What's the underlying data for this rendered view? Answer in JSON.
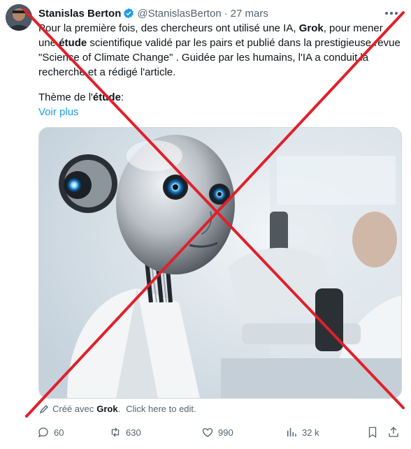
{
  "tweet": {
    "author_name": "Stanislas Berton",
    "handle": "@StanislasBerton",
    "separator": "·",
    "date": "27 mars",
    "text_segments": [
      "Pour la première fois, des chercheurs ont utilisé une IA, ",
      "Grok",
      ", pour mener une ",
      "étude",
      " scientifique validé par les pairs et publié dans la prestigieuse revue \"Science of Climate Change\" . Guidée par les humains, l'IA a conduit la recherche et a rédigé l'article."
    ],
    "theme_prefix": "Thème de l'",
    "theme_bold": "étude",
    "theme_suffix": ":",
    "see_more": "Voir plus",
    "created_prefix": "Créé avec",
    "created_brand": "Grok",
    "created_suffix": ".",
    "created_edit": "Click here to edit."
  },
  "actions": {
    "replies": "60",
    "reposts": "630",
    "likes": "990",
    "views": "32 k"
  },
  "icons": {
    "verified": "verified-badge-icon",
    "more": "more-horizontal-icon",
    "pen": "pen-icon",
    "reply": "reply-icon",
    "repost": "repost-icon",
    "like": "heart-icon",
    "views": "views-bar-chart-icon",
    "bookmark": "bookmark-icon",
    "share": "share-icon"
  },
  "colors": {
    "accent": "#1d9bf0",
    "cross": "#e0202a",
    "muted": "#536471"
  }
}
